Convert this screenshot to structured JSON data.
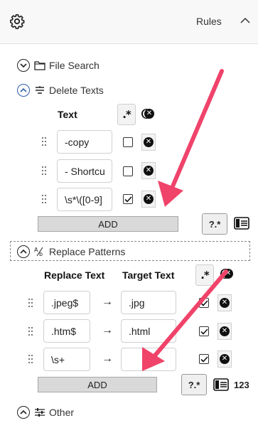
{
  "header": {
    "title": "Rules"
  },
  "sections": {
    "file_search": {
      "label": "File Search"
    },
    "delete_texts": {
      "label": "Delete Texts"
    },
    "replace_patterns": {
      "label": "Replace Patterns"
    },
    "other": {
      "label": "Other"
    }
  },
  "delete_texts": {
    "column_header": "Text",
    "regex_symbol": ".*",
    "rows": [
      {
        "text": "-copy",
        "regex": false
      },
      {
        "text": "- Shortcu",
        "regex": false
      },
      {
        "text": "\\s*\\([0-9]",
        "regex": true
      }
    ],
    "add_label": "ADD"
  },
  "replace_patterns": {
    "col_replace": "Replace Text",
    "col_target": "Target Text",
    "regex_symbol": ".*",
    "arrow": "→",
    "rows": [
      {
        "replace": ".jpeg$",
        "target": ".jpg",
        "regex": true
      },
      {
        "replace": ".htm$",
        "target": ".html",
        "regex": true
      },
      {
        "replace": "\\s+",
        "target": "",
        "regex": true
      }
    ],
    "add_label": "ADD",
    "count_label": "123"
  },
  "help_regex_symbol": "?.*",
  "icons": {
    "settings": "gear-icon",
    "collapse": "chevron-up-icon",
    "folder": "folder-icon",
    "filter": "filter-icon",
    "replace": "text-replace-icon",
    "sliders": "sliders-icon",
    "remove": "close-circle-icon",
    "grip": "drag-handle-icon"
  },
  "colors": {
    "annotation_arrow": "#f0436a"
  }
}
